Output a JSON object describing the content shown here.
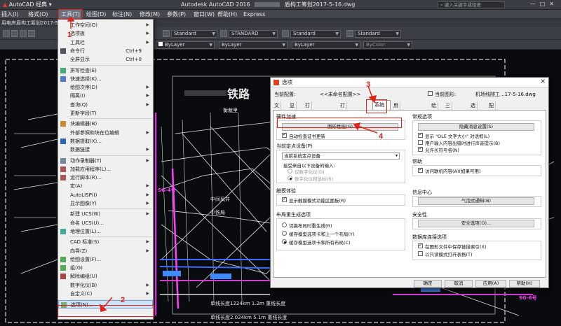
{
  "titlebar": {
    "workspace": "AutoCAD 经典",
    "app_title": "Autodesk AutoCAD 2016",
    "file_title": "盾构工筹划2017-5-16.dwg",
    "search_placeholder": "键入关键字或短语"
  },
  "menubar": {
    "items": [
      "插入(I)",
      "格式(O)",
      "工具(T)",
      "绘图(D)",
      "标注(N)",
      "修改(M)",
      "参数(P)",
      "窗口(W)",
      "帮助(H)",
      "Express"
    ]
  },
  "file_tab": "用电房盾构工筹划2017-5-1...",
  "toolbars": {
    "style_combos": [
      "Standard",
      "STANDARD",
      "Standard",
      "Standard"
    ],
    "layer_combos": [
      "ByLayer",
      "ByLayer",
      "ByLayer",
      "ByColor"
    ]
  },
  "drawing": {
    "title_text": "铁路",
    "labels": [
      "衡裁里",
      "SG-4号",
      "中间风井",
      "SG-6号",
      "中铁局",
      "单线长度1224km  1.2m 重线长度",
      "单线长度2.024km  5.1m 重线长度"
    ]
  },
  "tools_menu": {
    "items": [
      {
        "label": "工作空间(O)",
        "shortcut": "",
        "submenu": true
      },
      {
        "label": "选项板",
        "shortcut": "",
        "submenu": true
      },
      {
        "label": "工具栏",
        "shortcut": "",
        "submenu": true
      },
      {
        "label": "命令行",
        "shortcut": "Ctrl+9",
        "submenu": false
      },
      {
        "label": "全屏显示",
        "shortcut": "Ctrl+0",
        "submenu": false
      },
      {
        "label": "拼写检查(E)",
        "shortcut": "",
        "submenu": false
      },
      {
        "label": "快速选择(K)...",
        "shortcut": "",
        "submenu": false
      },
      {
        "label": "绘图次序(D)",
        "shortcut": "",
        "submenu": true
      },
      {
        "label": "隔离(I)",
        "shortcut": "",
        "submenu": true
      },
      {
        "label": "查询(Q)",
        "shortcut": "",
        "submenu": true
      },
      {
        "label": "更新字段(T)",
        "shortcut": "",
        "submenu": false
      },
      {
        "label": "块编辑器(B)",
        "shortcut": "",
        "submenu": false
      },
      {
        "label": "外部参照和块在位编辑",
        "shortcut": "",
        "submenu": true
      },
      {
        "label": "数据提取(X)...",
        "shortcut": "",
        "submenu": false
      },
      {
        "label": "数据链接",
        "shortcut": "",
        "submenu": true
      },
      {
        "label": "动作录制器(T)",
        "shortcut": "",
        "submenu": true
      },
      {
        "label": "加载应用程序(L)...",
        "shortcut": "",
        "submenu": false
      },
      {
        "label": "运行脚本(R)...",
        "shortcut": "",
        "submenu": false
      },
      {
        "label": "宏(A)",
        "shortcut": "",
        "submenu": true
      },
      {
        "label": "AutoLISP(I)",
        "shortcut": "",
        "submenu": true
      },
      {
        "label": "显示图像(Y)",
        "shortcut": "",
        "submenu": true
      },
      {
        "label": "新建 UCS(W)",
        "shortcut": "",
        "submenu": true
      },
      {
        "label": "命名 UCS(U)...",
        "shortcut": "",
        "submenu": false
      },
      {
        "label": "地理位置(L)...",
        "shortcut": "",
        "submenu": false
      },
      {
        "label": "CAD 标准(S)",
        "shortcut": "",
        "submenu": true
      },
      {
        "label": "向导(Z)",
        "shortcut": "",
        "submenu": true
      },
      {
        "label": "绘图设置(F)...",
        "shortcut": "",
        "submenu": false
      },
      {
        "label": "组(G)",
        "shortcut": "",
        "submenu": false
      },
      {
        "label": "解除编组(U)",
        "shortcut": "",
        "submenu": false
      },
      {
        "label": "数字化仪(B)",
        "shortcut": "",
        "submenu": true
      },
      {
        "label": "自定义(C)",
        "shortcut": "",
        "submenu": true
      },
      {
        "label": "选项(N)...",
        "shortcut": "",
        "submenu": false
      }
    ]
  },
  "dialog": {
    "title": "选项",
    "current_profile_label": "当前配置:",
    "current_profile_value": "<<未命名配置>>",
    "current_drawing_label": "当前图形:",
    "current_drawing_value": "机场线隧工...17-5-16.dwg",
    "tabs": [
      "文件",
      "显示",
      "打开和保存",
      "打印和发布",
      "系统",
      "用户系统配置",
      "绘图",
      "三维建模",
      "选择集",
      "配置"
    ],
    "hw_title": "硬件加速",
    "perf_button": "图形性能(G)",
    "auto_check_cert": "自动检查证书更新",
    "pointing_title": "当前定点设备(P)",
    "pointing_value": "当前系统定点设备",
    "accept_input_label": "接受来自以下设备的输入:",
    "digitizer_only": "仅数字化仪(D)",
    "digitizer_and_mouse": "数字化仪和鼠标(R)",
    "touch_title": "触摸体验",
    "touch_mode": "显示触摸模式功能区面板(R)",
    "regen_title": "布局重生成选项",
    "regen_opt1": "切换布局时重生成(R)",
    "regen_opt2": "缓存模型选项卡和上一个布局(Y)",
    "regen_opt3": "缓存模型选项卡和所有布局(C)",
    "general_title": "常规选项",
    "hidden_msg_button": "隐藏消息设置(S)",
    "ole_dialog": "显示 \"OLE 文字大小\" 对话框(L)",
    "beep_error": "用户输入内容出错时进行声音提示(B)",
    "long_names": "允许长符号名(N)",
    "help_title": "帮助",
    "online_help": "访问联机内容(A)(如果可用)",
    "info_title": "信息中心",
    "balloon_button": "气泡式通知(B)",
    "security_title": "安全性",
    "security_button": "安全选项(O)...",
    "db_title": "数据库连接选项",
    "db_opt1": "在图形文件中保存链接索引(X)",
    "db_opt2": "以只读模式打开表格(T)",
    "ok": "确定",
    "cancel": "取消",
    "apply": "应用(A)",
    "help": "帮助(H)"
  },
  "annotations": [
    "1",
    "2",
    "3",
    "4"
  ]
}
